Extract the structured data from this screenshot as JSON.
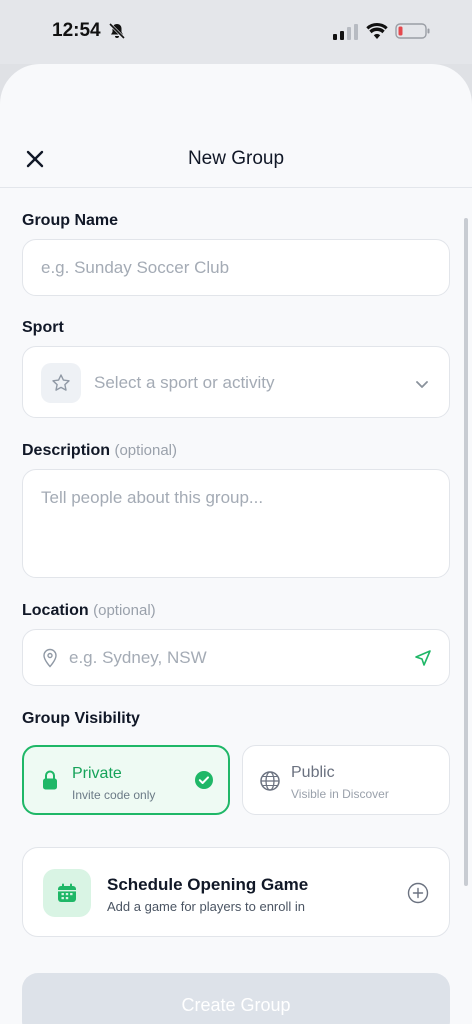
{
  "status_bar": {
    "time": "12:54"
  },
  "header": {
    "title": "New Group",
    "close_icon": "close-icon"
  },
  "form": {
    "group_name": {
      "label": "Group Name",
      "placeholder": "e.g. Sunday Soccer Club",
      "value": ""
    },
    "sport": {
      "label": "Sport",
      "placeholder": "Select a sport or activity",
      "icon": "star-icon"
    },
    "description": {
      "label": "Description",
      "optional": "(optional)",
      "placeholder": "Tell people about this group...",
      "value": ""
    },
    "location": {
      "label": "Location",
      "optional": "(optional)",
      "placeholder": "e.g. Sydney, NSW",
      "value": ""
    },
    "visibility": {
      "label": "Group Visibility",
      "options": [
        {
          "title": "Private",
          "subtitle": "Invite code only",
          "selected": true,
          "icon": "lock-icon"
        },
        {
          "title": "Public",
          "subtitle": "Visible in Discover",
          "selected": false,
          "icon": "globe-icon"
        }
      ]
    },
    "schedule": {
      "title": "Schedule Opening Game",
      "subtitle": "Add a game for players to enroll in",
      "icon": "calendar-icon"
    },
    "submit_label": "Create Group"
  },
  "colors": {
    "accent_green": "#1fb767",
    "private_bg": "#eefaf3",
    "disabled_button": "#dde2e9"
  }
}
